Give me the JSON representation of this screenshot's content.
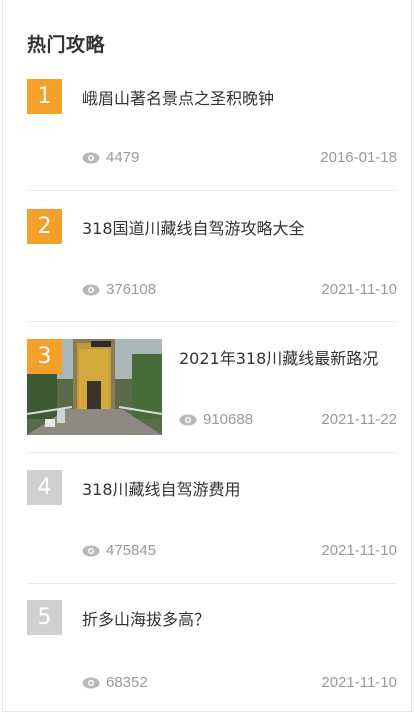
{
  "section": {
    "title": "热门攻略"
  },
  "items": [
    {
      "rank": "1",
      "title": "峨眉山著名景点之圣积晚钟",
      "views": "4479",
      "date": "2016-01-18",
      "has_image": false
    },
    {
      "rank": "2",
      "title": "318国道川藏线自驾游攻略大全",
      "views": "376108",
      "date": "2021-11-10",
      "has_image": false
    },
    {
      "rank": "3",
      "title": "2021年318川藏线最新路况",
      "views": "910688",
      "date": "2021-11-22",
      "has_image": true
    },
    {
      "rank": "4",
      "title": "318川藏线自驾游费用",
      "views": "475845",
      "date": "2021-11-10",
      "has_image": false
    },
    {
      "rank": "5",
      "title": "折多山海拔多高？",
      "views": "68352",
      "date": "2021-11-10",
      "has_image": false
    }
  ],
  "colors": {
    "rank_hot": "#f5a02a",
    "rank_cold": "#d0d0d0",
    "meta_text": "#9a9a9a"
  },
  "icons": {
    "views": "eye-icon"
  }
}
